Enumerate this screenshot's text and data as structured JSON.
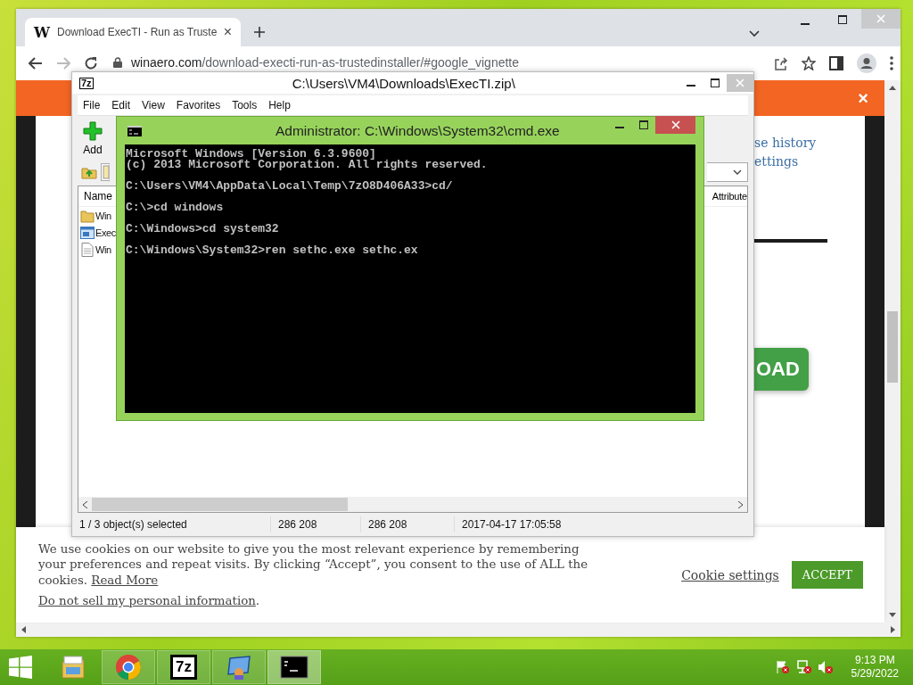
{
  "browser": {
    "tab": {
      "favicon": "W",
      "title": "Download ExecTI - Run as Truste",
      "selected": true,
      "close": "×"
    },
    "address": {
      "domain": "winaero.com",
      "path": "/download-execti-run-as-trustedinstaller/#google_vignette"
    },
    "page": {
      "banner_close": "×",
      "links": [
        "se history",
        "ettings"
      ],
      "download_button": "OAD",
      "cookie": {
        "text": "We use cookies on our website to give you the most relevant experience by remembering your preferences and repeat visits. By clicking “Accept”, you consent to the use of ALL the cookies. ",
        "read_more": "Read More",
        "do_not_sell": "Do not sell my personal information",
        "period": ".",
        "settings": "Cookie settings",
        "accept": "ACCEPT"
      }
    }
  },
  "archive_window": {
    "logo": "7z",
    "title": "C:\\Users\\VM4\\Downloads\\ExecTI.zip\\",
    "menu": [
      "File",
      "Edit",
      "View",
      "Favorites",
      "Tools",
      "Help"
    ],
    "toolbar": [
      {
        "label": "Add",
        "kind": "add"
      }
    ],
    "columns": [
      "Name",
      "Attribute"
    ],
    "rows": [
      {
        "name": "Win",
        "kind": "folder"
      },
      {
        "name": "Exec",
        "kind": "program"
      },
      {
        "name": "Win",
        "kind": "document"
      }
    ],
    "status_bar": [
      "1 / 3 object(s) selected",
      "286 208",
      "286 208",
      "2017-04-17 17:05:58"
    ]
  },
  "console_window": {
    "title": "Administrator: C:\\Windows\\System32\\cmd.exe",
    "blocks": [
      [
        "Microsoft Windows [Version 6.3.9600]",
        "(c) 2013 Microsoft Corporation. All rights reserved."
      ],
      [
        "C:\\Users\\VM4\\AppData\\Local\\Temp\\7zO8D406A33>cd/"
      ],
      [
        "C:\\>cd windows"
      ],
      [
        "C:\\Windows>cd system32"
      ],
      [
        "C:\\Windows\\System32>ren sethc.exe sethc.ex"
      ]
    ]
  },
  "taskbar": {
    "items": [
      {
        "kind": "explorer",
        "running": false,
        "selected": false
      },
      {
        "kind": "chrome",
        "running": true,
        "selected": false
      },
      {
        "kind": "sevenzip",
        "label": "7z",
        "running": true,
        "selected": false
      },
      {
        "kind": "remote",
        "running": true,
        "selected": false
      },
      {
        "kind": "console",
        "running": true,
        "selected": true
      }
    ],
    "time": "9:13 PM",
    "date": "5/29/2022"
  }
}
